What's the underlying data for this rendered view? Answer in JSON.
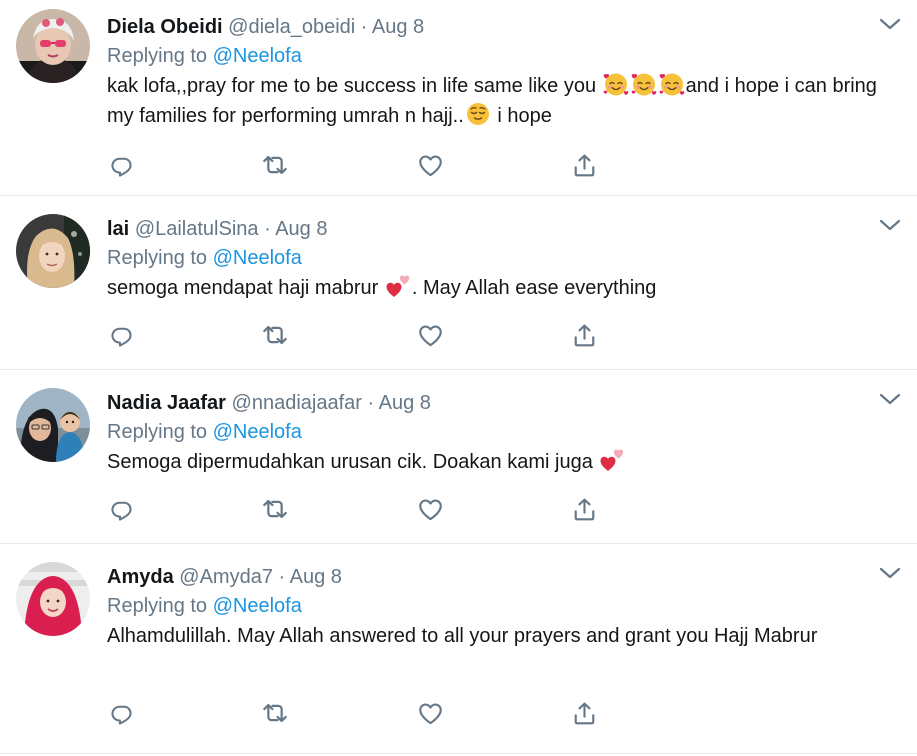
{
  "tweets": [
    {
      "name": "Diela Obeidi",
      "handle": "@diela_obeidi",
      "separator": "·",
      "date": "Aug 8",
      "replying_prefix": "Replying to",
      "replying_to": "@Neelofa",
      "text_1": "kak lofa,,pray for me to be success in life same like you",
      "text_2": "and i hope i can bring my families for performing umrah n hajj..",
      "text_3": " i hope",
      "emojis": [
        "smiling-face-with-hearts",
        "smiling-face-with-hearts",
        "smiling-face-with-hearts",
        "relieved-face"
      ]
    },
    {
      "name": "lai",
      "handle": "@LailatulSina",
      "separator": "·",
      "date": "Aug 8",
      "replying_prefix": "Replying to",
      "replying_to": "@Neelofa",
      "text_1": "semoga mendapat haji mabrur",
      "text_2": ". May Allah ease everything",
      "emojis": [
        "two-hearts"
      ]
    },
    {
      "name": "Nadia Jaafar",
      "handle": "@nnadiajaafar",
      "separator": "·",
      "date": "Aug 8",
      "replying_prefix": "Replying to",
      "replying_to": "@Neelofa",
      "text_1": "Semoga dipermudahkan urusan cik. Doakan kami juga",
      "emojis": [
        "two-hearts"
      ]
    },
    {
      "name": "Amyda",
      "handle": "@Amyda7",
      "separator": "·",
      "date": "Aug 8",
      "replying_prefix": "Replying to",
      "replying_to": "@Neelofa",
      "text_1": "Alhamdulillah. May Allah answered to all your prayers and grant you Hajj Mabrur"
    }
  ],
  "action_icons": [
    "reply-icon",
    "retweet-icon",
    "like-icon",
    "share-icon"
  ],
  "colors": {
    "text": "#14171a",
    "secondary": "#657786",
    "link": "#1b95e0",
    "icon": "#657786",
    "divider": "#e6ecf0"
  }
}
